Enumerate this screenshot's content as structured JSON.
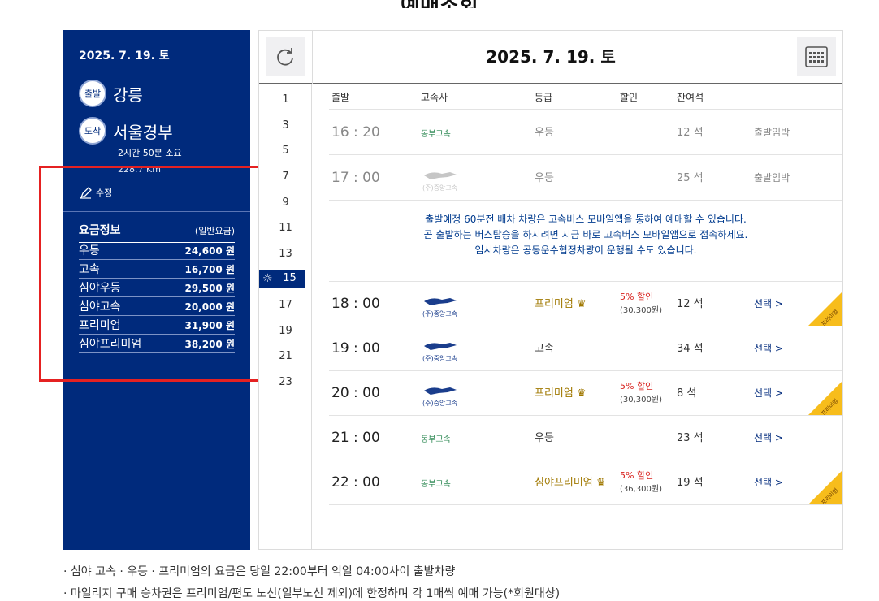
{
  "left": {
    "date": "2025. 7. 19. 토",
    "depart_badge": "출발",
    "depart_name": "강릉",
    "arrive_badge": "도착",
    "arrive_name": "서울경부",
    "duration": "2시간 50분 소요",
    "distance": "228.7 Km",
    "edit_label": "수정",
    "fare_title": "요금정보",
    "fare_type": "(일반요금)",
    "fares": [
      {
        "name": "우등",
        "price": "24,600 원"
      },
      {
        "name": "고속",
        "price": "16,700 원"
      },
      {
        "name": "심야우등",
        "price": "29,500 원"
      },
      {
        "name": "심야고속",
        "price": "20,000 원"
      },
      {
        "name": "프리미엄",
        "price": "31,900 원"
      },
      {
        "name": "심야프리미엄",
        "price": "38,200 원"
      }
    ]
  },
  "header": {
    "title": "2025. 7. 19. 토",
    "refresh_icon": "refresh-icon",
    "calendar_icon": "calendar-icon"
  },
  "hours": [
    "1",
    "3",
    "5",
    "7",
    "9",
    "11",
    "13",
    "15",
    "17",
    "19",
    "21",
    "23"
  ],
  "active_hour": "15",
  "columns": {
    "depart": "출발",
    "company": "고속사",
    "grade": "등급",
    "discount": "할인",
    "seats": "잔여석"
  },
  "rows": [
    {
      "time": "16 : 20",
      "company": "동부고속",
      "grade": "우등",
      "seats": "12 석",
      "action": "출발임박",
      "dim": true
    },
    {
      "time": "17 : 00",
      "company": "(주)중앙고속",
      "grade": "우등",
      "seats": "25 석",
      "action": "출발임박",
      "dim": true
    },
    {
      "time": "18 : 00",
      "company": "(주)중앙고속",
      "grade": "프리미엄",
      "discount": "5% 할인",
      "discount_price": "(30,300원)",
      "seats": "12 석",
      "action": "선택 >",
      "ribbon": "프리미엄"
    },
    {
      "time": "19 : 00",
      "company": "(주)중앙고속",
      "grade": "고속",
      "seats": "34 석",
      "action": "선택 >"
    },
    {
      "time": "20 : 00",
      "company": "(주)중앙고속",
      "grade": "프리미엄",
      "discount": "5% 할인",
      "discount_price": "(30,300원)",
      "seats": "8 석",
      "action": "선택 >",
      "ribbon": "프리미엄"
    },
    {
      "time": "21 : 00",
      "company": "동부고속",
      "grade": "우등",
      "seats": "23 석",
      "action": "선택 >"
    },
    {
      "time": "22 : 00",
      "company": "동부고속",
      "grade": "심야프리미엄",
      "discount": "5% 할인",
      "discount_price": "(36,300원)",
      "seats": "19 석",
      "action": "선택 >",
      "ribbon": "프리미엄"
    }
  ],
  "notice": [
    "출발예정 60분전 배차 차량은 고속버스 모바일앱을 통하여 예매할 수 있습니다.",
    "곧 출발하는 버스탑승을 하시려면 지금 바로 고속버스 모바일앱으로 접속하세요.",
    "임시차량은 공동운수협정차량이 운행될 수도 있습니다."
  ],
  "footnotes": [
    "· 심야 고속 · 우등 · 프리미엄의 요금은 당일 22:00부터 익일 04:00사이 출발차량",
    "· 마일리지 구매 승차권은 프리미엄/편도 노선(일부노선 제외)에 한정하며 각 1매씩 예매 가능(*회원대상)"
  ],
  "colors": {
    "navy": "#002a7c",
    "discount_red": "#d8201c",
    "premium_gold": "#a07800",
    "ribbon_yellow": "#f7bd1c",
    "annotation_red": "#e52121"
  }
}
